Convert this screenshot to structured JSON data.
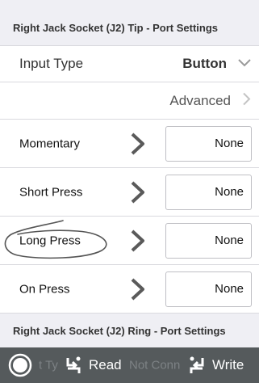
{
  "header_tip": "Right Jack Socket (J2) Tip - Port Settings",
  "input_type": {
    "label": "Input Type",
    "value": "Button"
  },
  "advanced": {
    "label": "Advanced"
  },
  "actions": [
    {
      "label": "Momentary",
      "value": "None"
    },
    {
      "label": "Short Press",
      "value": "None"
    },
    {
      "label": "Long Press",
      "value": "None"
    },
    {
      "label": "On Press",
      "value": "None"
    }
  ],
  "header_ring": "Right Jack Socket (J2) Ring - Port Settings",
  "bottom_bar": {
    "read_label": "Read",
    "write_label": "Write",
    "ghost_left": "t Ty",
    "ghost_mid": "Not Conn"
  },
  "icons": {
    "dropdown": "chevron-down-icon",
    "advanced": "chevron-right-icon",
    "action_arrow": "chevron-right-icon",
    "status": "power-circle-icon",
    "read": "read-transfer-icon",
    "write": "write-transfer-icon"
  },
  "colors": {
    "bottom_bar": "#555a5c",
    "chevron": "#5a5a5a",
    "background": "#efeff4"
  }
}
